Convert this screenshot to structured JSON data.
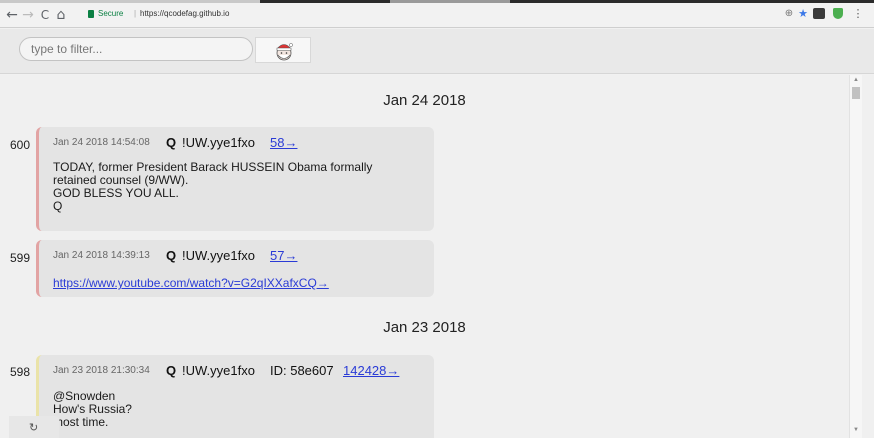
{
  "browser": {
    "back_glyph": "←",
    "forward_glyph": "→",
    "reload_glyph": "C",
    "home_glyph": "⌂",
    "secure_label": "Secure",
    "separator": "|",
    "url": "https://qcodefag.github.io",
    "zoom_glyph": "⊕",
    "star_glyph": "★",
    "menu_glyph": "⋮",
    "colors": {
      "secure": "#0b8043",
      "star": "#3b78e7",
      "shield": "#4caf50"
    }
  },
  "filter": {
    "placeholder": "type to filter..."
  },
  "groups": [
    {
      "date": "Jan 24 2018"
    },
    {
      "date": "Jan 23 2018"
    }
  ],
  "posts": [
    {
      "number": "600",
      "timestamp": "Jan 24 2018 14:54:08",
      "author": "Q",
      "trip": "!UW.yye1fxo",
      "link": "58→",
      "body": "TODAY, former President Barack HUSSEIN Obama formally\nretained counsel (9/WW).\nGOD BLESS YOU ALL.\nQ"
    },
    {
      "number": "599",
      "timestamp": "Jan 24 2018 14:39:13",
      "author": "Q",
      "trip": "!UW.yye1fxo",
      "link": "57→",
      "url": "https://www.youtube.com/watch?v=G2qIXXafxCQ→"
    },
    {
      "number": "598",
      "timestamp": "Jan 23 2018 21:30:34",
      "author": "Q",
      "trip": "!UW.yye1fxo",
      "id": "ID: 58e607",
      "link": "142428→",
      "body": "@Snowden\nHow's Russia?\n  most time."
    }
  ],
  "refresh_glyph": "↻"
}
